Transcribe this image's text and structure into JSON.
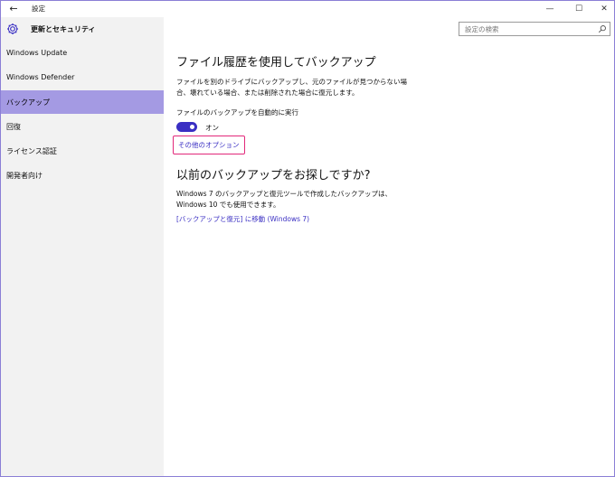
{
  "window": {
    "title": "設定",
    "back_icon": "←",
    "minimize": "—",
    "maximize": "☐",
    "close": "✕"
  },
  "sidebar": {
    "header": "更新とセキュリティ",
    "items": [
      {
        "label": "Windows Update"
      },
      {
        "label": "Windows Defender"
      },
      {
        "label": "バックアップ",
        "active": true
      },
      {
        "label": "回復"
      },
      {
        "label": "ライセンス認証"
      },
      {
        "label": "開発者向け"
      }
    ]
  },
  "search": {
    "placeholder": "設定の検索"
  },
  "main": {
    "heading": "ファイル履歴を使用してバックアップ",
    "description": "ファイルを別のドライブにバックアップし、元のファイルが見つからない場合、壊れている場合、または削除された場合に復元します。",
    "toggle_label": "ファイルのバックアップを自動的に実行",
    "toggle_state": "オン",
    "more_options": "その他のオプション",
    "heading2": "以前のバックアップをお探しですか?",
    "description2": "Windows 7 のバックアップと復元ツールで作成したバックアップは、Windows 10 でも使用できます。",
    "legacy_link": "[バックアップと復元] に移動 (Windows 7)"
  },
  "colors": {
    "accent": "#3a2fc3",
    "selection": "#a49ae3",
    "focus_border": "#e2287a",
    "sidebar_bg": "#f2f2f2"
  }
}
